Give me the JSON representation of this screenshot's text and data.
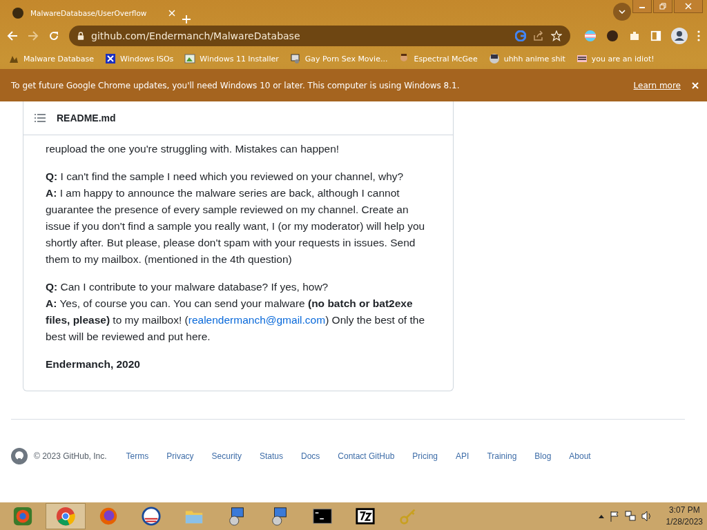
{
  "browser": {
    "tab": {
      "title": "MalwareDatabase/UserOverflow"
    },
    "address": "github.com/Endermanch/MalwareDatabase",
    "bookmarks": [
      "Malware Database",
      "Windows ISOs",
      "Windows 11 Installer",
      "Gay Porn Sex Movie...",
      "Espectral McGee",
      "uhhh anime shit",
      "you are an idiot!"
    ],
    "infobar": {
      "message": "To get future Google Chrome updates, you'll need Windows 10 or later. This computer is using Windows 8.1.",
      "link": "Learn more"
    }
  },
  "readme": {
    "title": "README.md",
    "paragraphs": [
      [
        {
          "kind": "text",
          "text": "reupload the one you're struggling with. Mistakes can happen!"
        }
      ],
      [
        {
          "kind": "text",
          "text": "**Q:** I can't find the sample I need which you reviewed on your channel, why?"
        },
        {
          "kind": "break"
        },
        {
          "kind": "text",
          "text": "**A:** I am happy to announce the malware series are back, although I cannot guarantee the presence of every sample reviewed on my channel. Create an issue if you don't find a sample you really want, I (or my moderator) will help you shortly after. But please, please don't spam with your requests in issues. Send them to my mailbox. (mentioned in the 4th question)"
        }
      ],
      [
        {
          "kind": "text",
          "text": "**Q:** Can I contribute to your malware database? If yes, how?"
        },
        {
          "kind": "break"
        },
        {
          "kind": "text",
          "text": "**A:** Yes, of course you can. You can send your malware **(no batch or bat2exe files, please)** to my mailbox! ("
        },
        {
          "kind": "link",
          "text": "realendermanch@gmail.com"
        },
        {
          "kind": "text",
          "text": ") Only the best of the best will be reviewed and put here."
        }
      ],
      [
        {
          "kind": "signature",
          "text": "Endermanch, 2020"
        }
      ]
    ]
  },
  "footer": {
    "copyright": "© 2023 GitHub, Inc.",
    "links": [
      "Terms",
      "Privacy",
      "Security",
      "Status",
      "Docs",
      "Contact GitHub",
      "Pricing",
      "API",
      "Training",
      "Blog",
      "About"
    ]
  },
  "taskbar": {
    "apps": [
      {
        "selected": false
      },
      {
        "selected": true
      },
      {
        "selected": false
      },
      {
        "selected": false
      },
      {
        "selected": false
      },
      {
        "selected": false
      },
      {
        "selected": false
      },
      {
        "selected": false
      },
      {
        "selected": false
      },
      {
        "selected": false
      }
    ],
    "time": "3:07 PM",
    "date": "1/28/2023"
  }
}
